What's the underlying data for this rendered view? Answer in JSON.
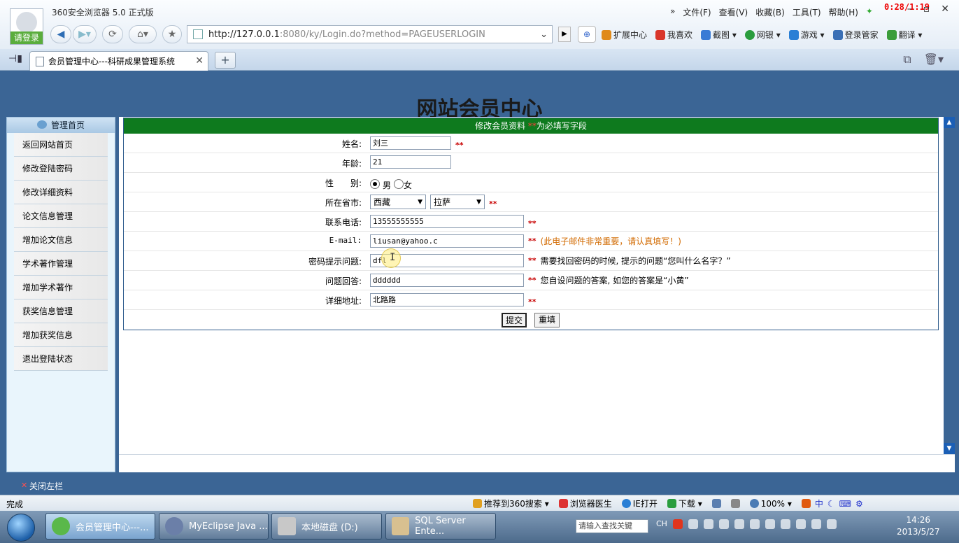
{
  "browser": {
    "app_title": "360安全浏览器 5.0 正式版",
    "login_label": "请登录",
    "menu": [
      "»",
      "文件(F)",
      "查看(V)",
      "收藏(B)",
      "工具(T)",
      "帮助(H)"
    ],
    "recording_time": "0:28/1:19",
    "url_host": "http://127.0.0.1",
    "url_rest": ":8080/ky/Login.do?method=PAGEUSERLOGIN",
    "extensions": [
      {
        "label": "扩展中心",
        "color": "#e08a1a"
      },
      {
        "label": "我喜欢",
        "color": "#d9362b"
      },
      {
        "label": "截图 ▾",
        "color": "#3a7bd5"
      },
      {
        "label": "网银 ▾",
        "color": "#2a9d3e"
      },
      {
        "label": "游戏 ▾",
        "color": "#2a7fd5"
      },
      {
        "label": "登录管家",
        "color": "#3a6fb5"
      },
      {
        "label": "翻译 ▾",
        "color": "#3b9d3b"
      }
    ],
    "tab_title": "会员管理中心---科研成果管理系统"
  },
  "site": {
    "title": "网站会员中心",
    "left_head": "管理首页",
    "nav": [
      "返回网站首页",
      "修改登陆密码",
      "修改详细资料",
      "论文信息管理",
      "增加论文信息",
      "学术著作管理",
      "增加学术著作",
      "获奖信息管理",
      "增加获奖信息",
      "退出登陆状态"
    ],
    "close_left": "关闭左栏"
  },
  "form": {
    "head_text": "修改会员资料",
    "head_stars": "**",
    "head_suffix": "为必填写字段",
    "req": "**",
    "name": {
      "label": "姓名:",
      "value": "刘三"
    },
    "age": {
      "label": "年龄:",
      "value": "21"
    },
    "gender": {
      "label": "性　　别:",
      "male": "男",
      "female": "女",
      "selected": "男"
    },
    "province": {
      "label": "所在省市:",
      "province": "西藏",
      "city": "拉萨"
    },
    "phone": {
      "label": "联系电话:",
      "value": "13555555555"
    },
    "email": {
      "label": "E-mail:",
      "value": "liusan@yahoo.c",
      "hint": "(此电子邮件非常重要，请认真填写！)"
    },
    "question": {
      "label": "密码提示问题:",
      "value": "dfl",
      "hint": "需要找回密码的时候, 提示的问题“您叫什么名字？”"
    },
    "answer": {
      "label": "问题回答:",
      "value": "dddddd",
      "hint": "您自设问题的答案, 如您的答案是“小黄”"
    },
    "address": {
      "label": "详细地址:",
      "value": "北路路"
    },
    "submit": "提交",
    "reset": "重填"
  },
  "status": {
    "text": "完成",
    "tools": [
      {
        "label": "推荐到360搜索 ▾",
        "color": "#e0a020"
      },
      {
        "label": "浏览器医生",
        "color": "#d33"
      },
      {
        "label": "IE打开",
        "color": "#2a7fd5"
      },
      {
        "label": "下载 ▾",
        "color": "#2a9d3e"
      },
      {
        "label": "",
        "color": "#5b7fb0"
      },
      {
        "label": "",
        "color": "#888"
      },
      {
        "label": "100% ▾",
        "color": "#4a7bb5"
      }
    ]
  },
  "taskbar": {
    "tasks": [
      "会员管理中心---...",
      "MyEclipse Java ...",
      "本地磁盘 (D:)",
      "SQL Server Ente..."
    ],
    "search_placeholder": "请输入查找关键",
    "lang": "CH",
    "time": "14:26",
    "date": "2013/5/27"
  }
}
